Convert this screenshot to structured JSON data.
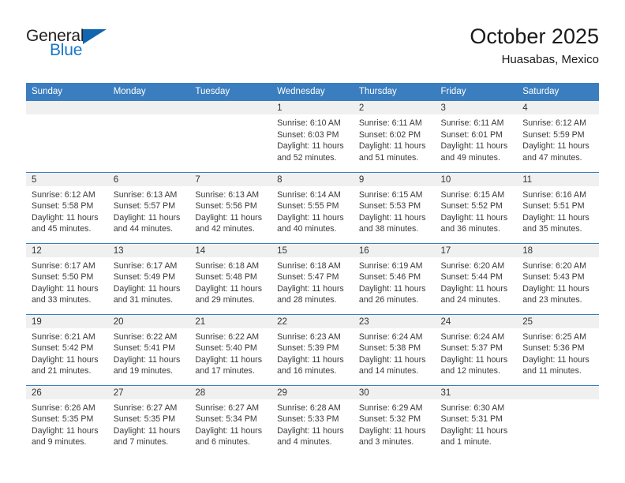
{
  "brand": {
    "name_top": "General",
    "name_bottom": "Blue",
    "accent_color": "#1266b0",
    "text_color": "#231f20"
  },
  "header": {
    "title": "October 2025",
    "location": "Huasabas, Mexico"
  },
  "calendar": {
    "header_bg": "#3b7ebf",
    "daynum_bg": "#f0f0f0",
    "weekdays": [
      "Sunday",
      "Monday",
      "Tuesday",
      "Wednesday",
      "Thursday",
      "Friday",
      "Saturday"
    ],
    "weeks": [
      [
        {
          "day": ""
        },
        {
          "day": ""
        },
        {
          "day": ""
        },
        {
          "day": "1",
          "sunrise": "Sunrise: 6:10 AM",
          "sunset": "Sunset: 6:03 PM",
          "daylight_1": "Daylight: 11 hours",
          "daylight_2": "and 52 minutes."
        },
        {
          "day": "2",
          "sunrise": "Sunrise: 6:11 AM",
          "sunset": "Sunset: 6:02 PM",
          "daylight_1": "Daylight: 11 hours",
          "daylight_2": "and 51 minutes."
        },
        {
          "day": "3",
          "sunrise": "Sunrise: 6:11 AM",
          "sunset": "Sunset: 6:01 PM",
          "daylight_1": "Daylight: 11 hours",
          "daylight_2": "and 49 minutes."
        },
        {
          "day": "4",
          "sunrise": "Sunrise: 6:12 AM",
          "sunset": "Sunset: 5:59 PM",
          "daylight_1": "Daylight: 11 hours",
          "daylight_2": "and 47 minutes."
        }
      ],
      [
        {
          "day": "5",
          "sunrise": "Sunrise: 6:12 AM",
          "sunset": "Sunset: 5:58 PM",
          "daylight_1": "Daylight: 11 hours",
          "daylight_2": "and 45 minutes."
        },
        {
          "day": "6",
          "sunrise": "Sunrise: 6:13 AM",
          "sunset": "Sunset: 5:57 PM",
          "daylight_1": "Daylight: 11 hours",
          "daylight_2": "and 44 minutes."
        },
        {
          "day": "7",
          "sunrise": "Sunrise: 6:13 AM",
          "sunset": "Sunset: 5:56 PM",
          "daylight_1": "Daylight: 11 hours",
          "daylight_2": "and 42 minutes."
        },
        {
          "day": "8",
          "sunrise": "Sunrise: 6:14 AM",
          "sunset": "Sunset: 5:55 PM",
          "daylight_1": "Daylight: 11 hours",
          "daylight_2": "and 40 minutes."
        },
        {
          "day": "9",
          "sunrise": "Sunrise: 6:15 AM",
          "sunset": "Sunset: 5:53 PM",
          "daylight_1": "Daylight: 11 hours",
          "daylight_2": "and 38 minutes."
        },
        {
          "day": "10",
          "sunrise": "Sunrise: 6:15 AM",
          "sunset": "Sunset: 5:52 PM",
          "daylight_1": "Daylight: 11 hours",
          "daylight_2": "and 36 minutes."
        },
        {
          "day": "11",
          "sunrise": "Sunrise: 6:16 AM",
          "sunset": "Sunset: 5:51 PM",
          "daylight_1": "Daylight: 11 hours",
          "daylight_2": "and 35 minutes."
        }
      ],
      [
        {
          "day": "12",
          "sunrise": "Sunrise: 6:17 AM",
          "sunset": "Sunset: 5:50 PM",
          "daylight_1": "Daylight: 11 hours",
          "daylight_2": "and 33 minutes."
        },
        {
          "day": "13",
          "sunrise": "Sunrise: 6:17 AM",
          "sunset": "Sunset: 5:49 PM",
          "daylight_1": "Daylight: 11 hours",
          "daylight_2": "and 31 minutes."
        },
        {
          "day": "14",
          "sunrise": "Sunrise: 6:18 AM",
          "sunset": "Sunset: 5:48 PM",
          "daylight_1": "Daylight: 11 hours",
          "daylight_2": "and 29 minutes."
        },
        {
          "day": "15",
          "sunrise": "Sunrise: 6:18 AM",
          "sunset": "Sunset: 5:47 PM",
          "daylight_1": "Daylight: 11 hours",
          "daylight_2": "and 28 minutes."
        },
        {
          "day": "16",
          "sunrise": "Sunrise: 6:19 AM",
          "sunset": "Sunset: 5:46 PM",
          "daylight_1": "Daylight: 11 hours",
          "daylight_2": "and 26 minutes."
        },
        {
          "day": "17",
          "sunrise": "Sunrise: 6:20 AM",
          "sunset": "Sunset: 5:44 PM",
          "daylight_1": "Daylight: 11 hours",
          "daylight_2": "and 24 minutes."
        },
        {
          "day": "18",
          "sunrise": "Sunrise: 6:20 AM",
          "sunset": "Sunset: 5:43 PM",
          "daylight_1": "Daylight: 11 hours",
          "daylight_2": "and 23 minutes."
        }
      ],
      [
        {
          "day": "19",
          "sunrise": "Sunrise: 6:21 AM",
          "sunset": "Sunset: 5:42 PM",
          "daylight_1": "Daylight: 11 hours",
          "daylight_2": "and 21 minutes."
        },
        {
          "day": "20",
          "sunrise": "Sunrise: 6:22 AM",
          "sunset": "Sunset: 5:41 PM",
          "daylight_1": "Daylight: 11 hours",
          "daylight_2": "and 19 minutes."
        },
        {
          "day": "21",
          "sunrise": "Sunrise: 6:22 AM",
          "sunset": "Sunset: 5:40 PM",
          "daylight_1": "Daylight: 11 hours",
          "daylight_2": "and 17 minutes."
        },
        {
          "day": "22",
          "sunrise": "Sunrise: 6:23 AM",
          "sunset": "Sunset: 5:39 PM",
          "daylight_1": "Daylight: 11 hours",
          "daylight_2": "and 16 minutes."
        },
        {
          "day": "23",
          "sunrise": "Sunrise: 6:24 AM",
          "sunset": "Sunset: 5:38 PM",
          "daylight_1": "Daylight: 11 hours",
          "daylight_2": "and 14 minutes."
        },
        {
          "day": "24",
          "sunrise": "Sunrise: 6:24 AM",
          "sunset": "Sunset: 5:37 PM",
          "daylight_1": "Daylight: 11 hours",
          "daylight_2": "and 12 minutes."
        },
        {
          "day": "25",
          "sunrise": "Sunrise: 6:25 AM",
          "sunset": "Sunset: 5:36 PM",
          "daylight_1": "Daylight: 11 hours",
          "daylight_2": "and 11 minutes."
        }
      ],
      [
        {
          "day": "26",
          "sunrise": "Sunrise: 6:26 AM",
          "sunset": "Sunset: 5:35 PM",
          "daylight_1": "Daylight: 11 hours",
          "daylight_2": "and 9 minutes."
        },
        {
          "day": "27",
          "sunrise": "Sunrise: 6:27 AM",
          "sunset": "Sunset: 5:35 PM",
          "daylight_1": "Daylight: 11 hours",
          "daylight_2": "and 7 minutes."
        },
        {
          "day": "28",
          "sunrise": "Sunrise: 6:27 AM",
          "sunset": "Sunset: 5:34 PM",
          "daylight_1": "Daylight: 11 hours",
          "daylight_2": "and 6 minutes."
        },
        {
          "day": "29",
          "sunrise": "Sunrise: 6:28 AM",
          "sunset": "Sunset: 5:33 PM",
          "daylight_1": "Daylight: 11 hours",
          "daylight_2": "and 4 minutes."
        },
        {
          "day": "30",
          "sunrise": "Sunrise: 6:29 AM",
          "sunset": "Sunset: 5:32 PM",
          "daylight_1": "Daylight: 11 hours",
          "daylight_2": "and 3 minutes."
        },
        {
          "day": "31",
          "sunrise": "Sunrise: 6:30 AM",
          "sunset": "Sunset: 5:31 PM",
          "daylight_1": "Daylight: 11 hours",
          "daylight_2": "and 1 minute."
        },
        {
          "day": ""
        }
      ]
    ]
  }
}
